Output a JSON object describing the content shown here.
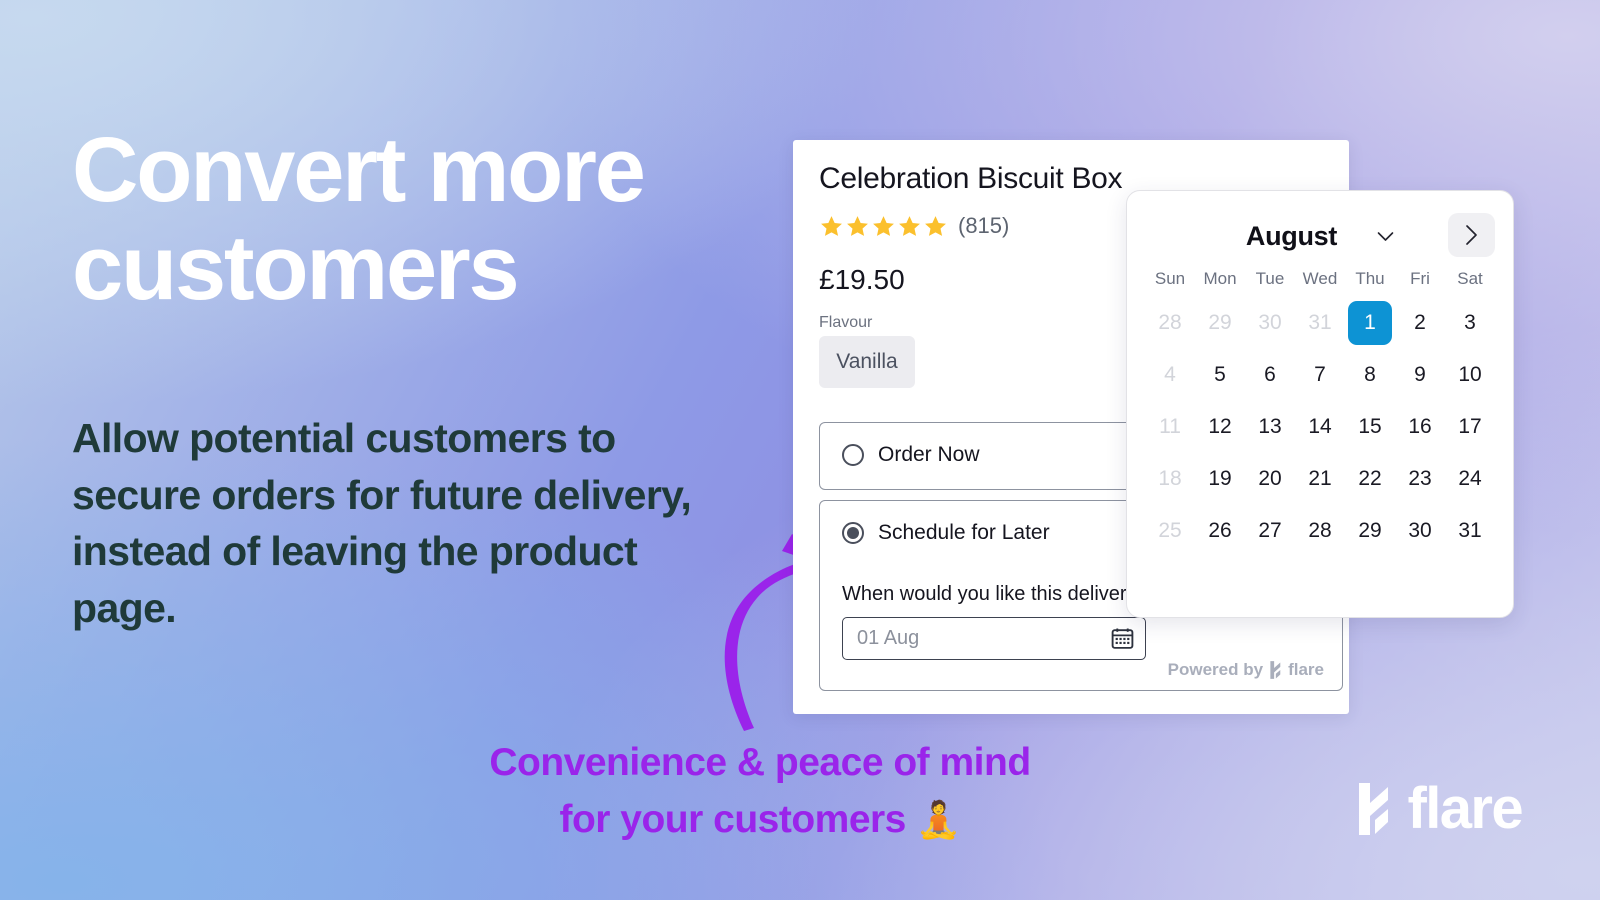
{
  "hero": {
    "headline": "Convert more customers",
    "subcopy": "Allow potential customers to secure orders for future delivery, instead of leaving the product page.",
    "caption_line1": "Convenience & peace of mind",
    "caption_line2": "for your customers",
    "caption_emoji": "🧘",
    "caption_color": "#9a24ea"
  },
  "brand": {
    "word": "flare",
    "mark": "flare-bolt-icon"
  },
  "product": {
    "title": "Celebration Biscuit Box",
    "rating_stars": 5,
    "rating_count": "(815)",
    "star_color": "#fbc02d",
    "price": "£19.50",
    "flavour_label": "Flavour",
    "flavour_value": "Vanilla",
    "options": [
      {
        "label": "Order Now",
        "selected": false
      },
      {
        "label": "Schedule for Later",
        "selected": true
      }
    ],
    "delivery_question": "When would you like this delivered?",
    "date_field_value": "01 Aug",
    "date_field_icon": "calendar-icon",
    "powered_by": "Powered by",
    "powered_brand": "flare"
  },
  "calendar": {
    "month": "August",
    "month_chevron": "chevron-down-icon",
    "next_icon": "chevron-right-icon",
    "weekdays": [
      "Sun",
      "Mon",
      "Tue",
      "Wed",
      "Thu",
      "Fri",
      "Sat"
    ],
    "selected_day": "1",
    "selected_color": "#0d93d4",
    "weeks": [
      [
        {
          "d": "28",
          "muted": true
        },
        {
          "d": "29",
          "muted": true
        },
        {
          "d": "30",
          "muted": true
        },
        {
          "d": "31",
          "muted": true
        },
        {
          "d": "1",
          "selected": true
        },
        {
          "d": "2"
        },
        {
          "d": "3"
        }
      ],
      [
        {
          "d": "4",
          "muted": true
        },
        {
          "d": "5"
        },
        {
          "d": "6"
        },
        {
          "d": "7"
        },
        {
          "d": "8"
        },
        {
          "d": "9"
        },
        {
          "d": "10"
        }
      ],
      [
        {
          "d": "11",
          "muted": true
        },
        {
          "d": "12"
        },
        {
          "d": "13"
        },
        {
          "d": "14"
        },
        {
          "d": "15"
        },
        {
          "d": "16"
        },
        {
          "d": "17"
        }
      ],
      [
        {
          "d": "18",
          "muted": true
        },
        {
          "d": "19"
        },
        {
          "d": "20"
        },
        {
          "d": "21"
        },
        {
          "d": "22"
        },
        {
          "d": "23"
        },
        {
          "d": "24"
        }
      ],
      [
        {
          "d": "25",
          "muted": true
        },
        {
          "d": "26"
        },
        {
          "d": "27"
        },
        {
          "d": "28"
        },
        {
          "d": "29"
        },
        {
          "d": "30"
        },
        {
          "d": "31"
        }
      ]
    ]
  }
}
